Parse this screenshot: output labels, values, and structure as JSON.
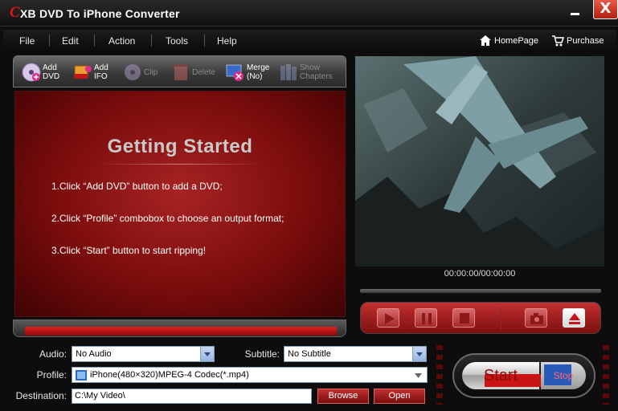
{
  "window": {
    "logo_letter": "C",
    "title": "XB DVD To iPhone Converter",
    "close_symbol": "X"
  },
  "menu": [
    "File",
    "Edit",
    "Action",
    "Tools",
    "Help"
  ],
  "top_links": {
    "homepage": "HomePage",
    "purchase": "Purchase"
  },
  "toolbar": {
    "add_dvd": [
      "Add",
      "DVD"
    ],
    "add_ifo": [
      "Add",
      "IFO"
    ],
    "clip": "Clip",
    "delete": "Delete",
    "merge": [
      "Merge",
      "(No)"
    ],
    "show_chapters": [
      "Show",
      "Chapters"
    ]
  },
  "getting_started": {
    "title": "Getting  Started",
    "steps": [
      "1.Click “Add DVD” button to add a DVD;",
      "2.Click “Profile” combobox to choose an output format;",
      "3.Click “Start” button to start ripping!"
    ]
  },
  "player": {
    "timecode": "00:00:00/00:00:00"
  },
  "form": {
    "audio_label": "Audio:",
    "audio_value": "No Audio",
    "subtitle_label": "Subtitle:",
    "subtitle_value": "No Subtitle",
    "profile_label": "Profile:",
    "profile_value": "iPhone(480×320)MPEG-4 Codec(*.mp4)",
    "destination_label": "Destination:",
    "destination_value": "C:\\My Video\\",
    "browse_label": "Browse",
    "open_label": "Open"
  },
  "start_label": "Start",
  "stop_label": "Stop",
  "colors": {
    "accent_red": "#c81414",
    "panel_red": "#7a0c0c",
    "background": "#0d0d0d"
  }
}
